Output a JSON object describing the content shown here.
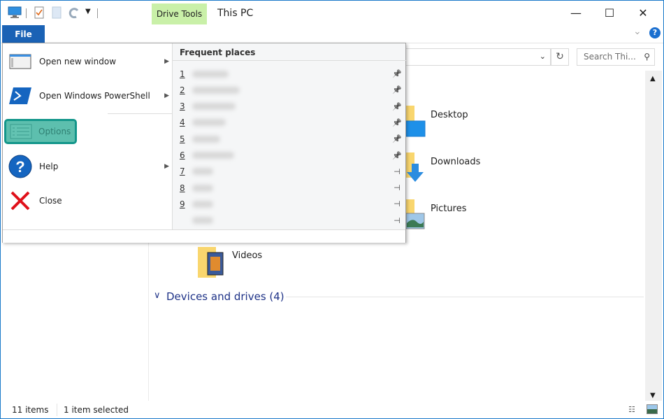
{
  "titlebar": {
    "context_tab": "Drive Tools",
    "title": "This PC",
    "minimize": "—",
    "maximize": "☐",
    "close": "✕"
  },
  "ribbon": {
    "file_tab": "File",
    "help_glyph": "?",
    "expand_glyph": "⌄"
  },
  "address": {
    "refresh_glyph": "↻",
    "search_placeholder": "Search Thi...",
    "search_icon": "search-icon"
  },
  "file_menu": {
    "items": [
      {
        "label": "Open new window",
        "has_submenu": true,
        "icon": "new-window-icon"
      },
      {
        "label": "Open Windows PowerShell",
        "has_submenu": true,
        "icon": "powershell-icon"
      },
      {
        "label": "Options",
        "has_submenu": false,
        "icon": "options-icon",
        "highlighted": true
      },
      {
        "label": "Help",
        "has_submenu": true,
        "icon": "help-icon"
      },
      {
        "label": "Close",
        "has_submenu": false,
        "icon": "close-icon"
      }
    ],
    "frequent_places_title": "Frequent places",
    "frequent_places": [
      {
        "num": "1",
        "pinned": true
      },
      {
        "num": "2",
        "pinned": true
      },
      {
        "num": "3",
        "pinned": true
      },
      {
        "num": "4",
        "pinned": true
      },
      {
        "num": "5",
        "pinned": true
      },
      {
        "num": "6",
        "pinned": true
      },
      {
        "num": "7",
        "pinned": false
      },
      {
        "num": "8",
        "pinned": false
      },
      {
        "num": "9",
        "pinned": false
      },
      {
        "num": "",
        "pinned": false
      }
    ]
  },
  "folders": [
    {
      "label": "Desktop"
    },
    {
      "label": "Downloads"
    },
    {
      "label": "Pictures"
    },
    {
      "label": "Videos"
    }
  ],
  "devices_header": "Devices and drives (4)",
  "status": {
    "items": "11 items",
    "selected": "1 item selected"
  },
  "colors": {
    "file_tab": "#1a62b5",
    "drive_tools": "#c9f0a8",
    "options_highlight": "#5dbfae",
    "section_header": "#1e3287"
  }
}
